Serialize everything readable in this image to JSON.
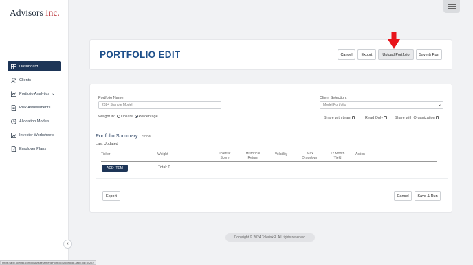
{
  "brand": {
    "name": "Advisors",
    "suffix": "Inc."
  },
  "sidebar": {
    "items": [
      {
        "label": "Dashboard",
        "icon": "dashboard-icon"
      },
      {
        "label": "Clients",
        "icon": "users-icon"
      },
      {
        "label": "Portfolio Analytics",
        "icon": "chart-icon"
      },
      {
        "label": "Risk Assessments",
        "icon": "document-icon"
      },
      {
        "label": "Allocation Models",
        "icon": "pie-icon"
      },
      {
        "label": "Investor Worksheets",
        "icon": "trend-icon"
      },
      {
        "label": "Employer Plans",
        "icon": "edit-document-icon"
      }
    ],
    "collapse_glyph": "‹"
  },
  "header": {
    "title": "PORTFOLIO EDIT",
    "buttons": {
      "cancel": "Cancel",
      "export": "Export",
      "upload": "Upload Portfolio",
      "save_run": "Save & Run"
    }
  },
  "form": {
    "portfolio_name_label": "Portfolio Name:",
    "portfolio_name_value": "2024 Sample Model",
    "client_selection_label": "Client Selection:",
    "client_selection_value": "Model Portfolio",
    "weight_in_label": "Weight in:",
    "weight_options": [
      "Dollars",
      "Percentage"
    ],
    "weight_selected": "Percentage",
    "share_with_team": "Share with team",
    "read_only": "Read Only",
    "share_with_org": "Share with Organization"
  },
  "summary": {
    "title": "Portfolio Summary",
    "toggle": "Show",
    "last_updated_label": "Last Updated",
    "columns": {
      "ticker": "Ticker",
      "weight": "Weight",
      "tolerisk_1": "Tolerisk",
      "tolerisk_2": "Score",
      "historical_1": "Historical",
      "historical_2": "Return",
      "volatility": "Volatility",
      "max_1": "Max",
      "max_2": "Drawdown",
      "month_1": "12 Month",
      "month_2": "Yield",
      "action": "Action"
    },
    "add_item": "ADD ITEM",
    "total": "Total: 0"
  },
  "bottom_buttons": {
    "export": "Export",
    "cancel": "Cancel",
    "save_run": "Save & Run"
  },
  "footer": {
    "copyright": "Copyright © 2024 ToleriskR. All rights reserved."
  },
  "status_bar": {
    "url": "https://app.tolerisk.com/RiskAssessment/PortfolioModelEdit.aspx?id=3427#"
  },
  "colors": {
    "accent": "#1d3557",
    "title": "#1d4f8a",
    "brand_red": "#b5252a",
    "arrow": "#e8141b"
  }
}
